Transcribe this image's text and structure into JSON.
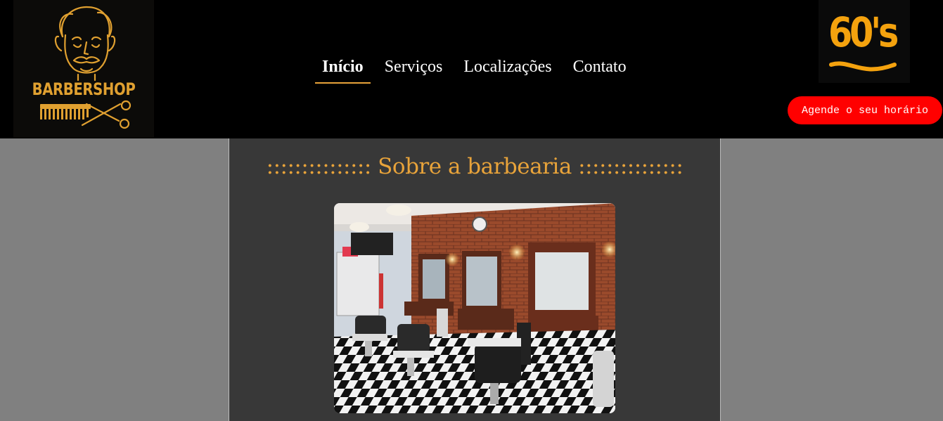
{
  "logo": {
    "text": "BARBERSHOP",
    "icon": "barber-face-icon"
  },
  "nav": {
    "items": [
      {
        "label": "Início",
        "active": true
      },
      {
        "label": "Serviços",
        "active": false
      },
      {
        "label": "Localizações",
        "active": false
      },
      {
        "label": "Contato",
        "active": false
      }
    ]
  },
  "brand": {
    "text": "60's"
  },
  "cta": {
    "label": "Agende o seu horário"
  },
  "section": {
    "title": "::::::::::::::: Sobre a barbearia :::::::::::::::"
  },
  "photo": {
    "subject": "barbershop-interior"
  },
  "colors": {
    "accent": "#e8a33a",
    "cta": "#ff0000",
    "header_bg": "#000000",
    "page_bg": "#808080",
    "content_bg": "#383838"
  }
}
